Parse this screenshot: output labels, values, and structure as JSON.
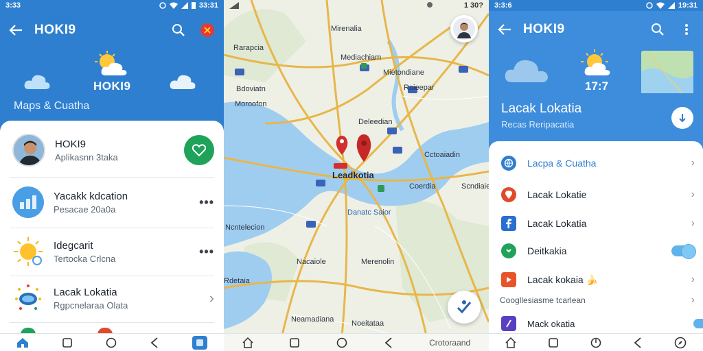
{
  "left_screen": {
    "status_time": "3:33",
    "status_right": "33:31",
    "app_title": "HOKI9",
    "weather_title": "HOKI9",
    "weather_subtitle": "Maps & Cuatha",
    "list": [
      {
        "title": "HOKI9",
        "subtitle": "Aplikasnn 3taka",
        "icon": "user-avatar",
        "action_icon": "heart-icon"
      },
      {
        "title": "Yacakk kdcation",
        "subtitle": "Pesacae 20a0a",
        "icon": "bar-chart-icon",
        "action_icon": "more-icon"
      },
      {
        "title": "Idegcarit",
        "subtitle": "Tertocka Crlcna",
        "icon": "sun-icon",
        "action_icon": "more-icon"
      },
      {
        "title": "Lacak Lokatia",
        "subtitle": "Rgpcnelaraa Olata",
        "icon": "cloud-badge-icon",
        "action_icon": "chevron-right-icon"
      }
    ],
    "more_glyph": "•••",
    "chevron_glyph": "›",
    "accent": "#2f7fd0",
    "favorite_color": "#1fa25a"
  },
  "map_screen": {
    "status_right": "1 30?",
    "labels": {
      "top": "Mirenalia",
      "nw": "Rarapcia",
      "center_north": "Mediachiam",
      "east": "Mietondiane",
      "north_east": "Roieepar",
      "west_1": "Bdoviatn",
      "west_2": "Moroofon",
      "west_3": "Deleedian",
      "center": "Leadkotia",
      "east_2": "Cctoaiadin",
      "east_3": "Coerdia",
      "east_4": "Scndiaie",
      "river_label": "Danatc Saior",
      "south_west": "Ncntelecion",
      "south_1": "Nacaiole",
      "south_2": "Merenolin",
      "south_west_2": "Rdetaia",
      "bottom_1": "Neamadiana",
      "bottom_2": "Noeitataa"
    },
    "bottom_label": "Crotoraand",
    "water_color": "#9fcdf0",
    "road_color": "#e8b64a",
    "pin_color": "#d32f2f"
  },
  "right_screen": {
    "status_time": "3:3:6",
    "status_right": "19:31",
    "app_title": "HOKI9",
    "time": "17:7",
    "title": "Lacak Lokatia",
    "subtitle": "Recas Reripacatia",
    "menu": [
      {
        "label": "Lacpa & Cuatha",
        "icon": "globe-icon",
        "color": "#2f7fd0",
        "trailing": "chevron"
      },
      {
        "label": "Lacak Lokatie",
        "icon": "location-icon",
        "color": "#e04a2a",
        "trailing": "chevron"
      },
      {
        "label": "Lacak Lokatia",
        "icon": "facebook-icon",
        "color": "#2a6fd0",
        "trailing": "chevron"
      },
      {
        "label": "Deitkakia",
        "icon": "whatsapp-icon",
        "color": "#1fa25a",
        "trailing": "toggle"
      },
      {
        "label": "Lacak kokaia 🍌",
        "icon": "youtube-icon",
        "color": "#e8542a",
        "trailing": "chevron"
      }
    ],
    "section_label": "Coogllesiasme tcarlean",
    "last_item": "Mack okatia",
    "chevron_glyph": "›",
    "accent": "#3d8ddc"
  }
}
